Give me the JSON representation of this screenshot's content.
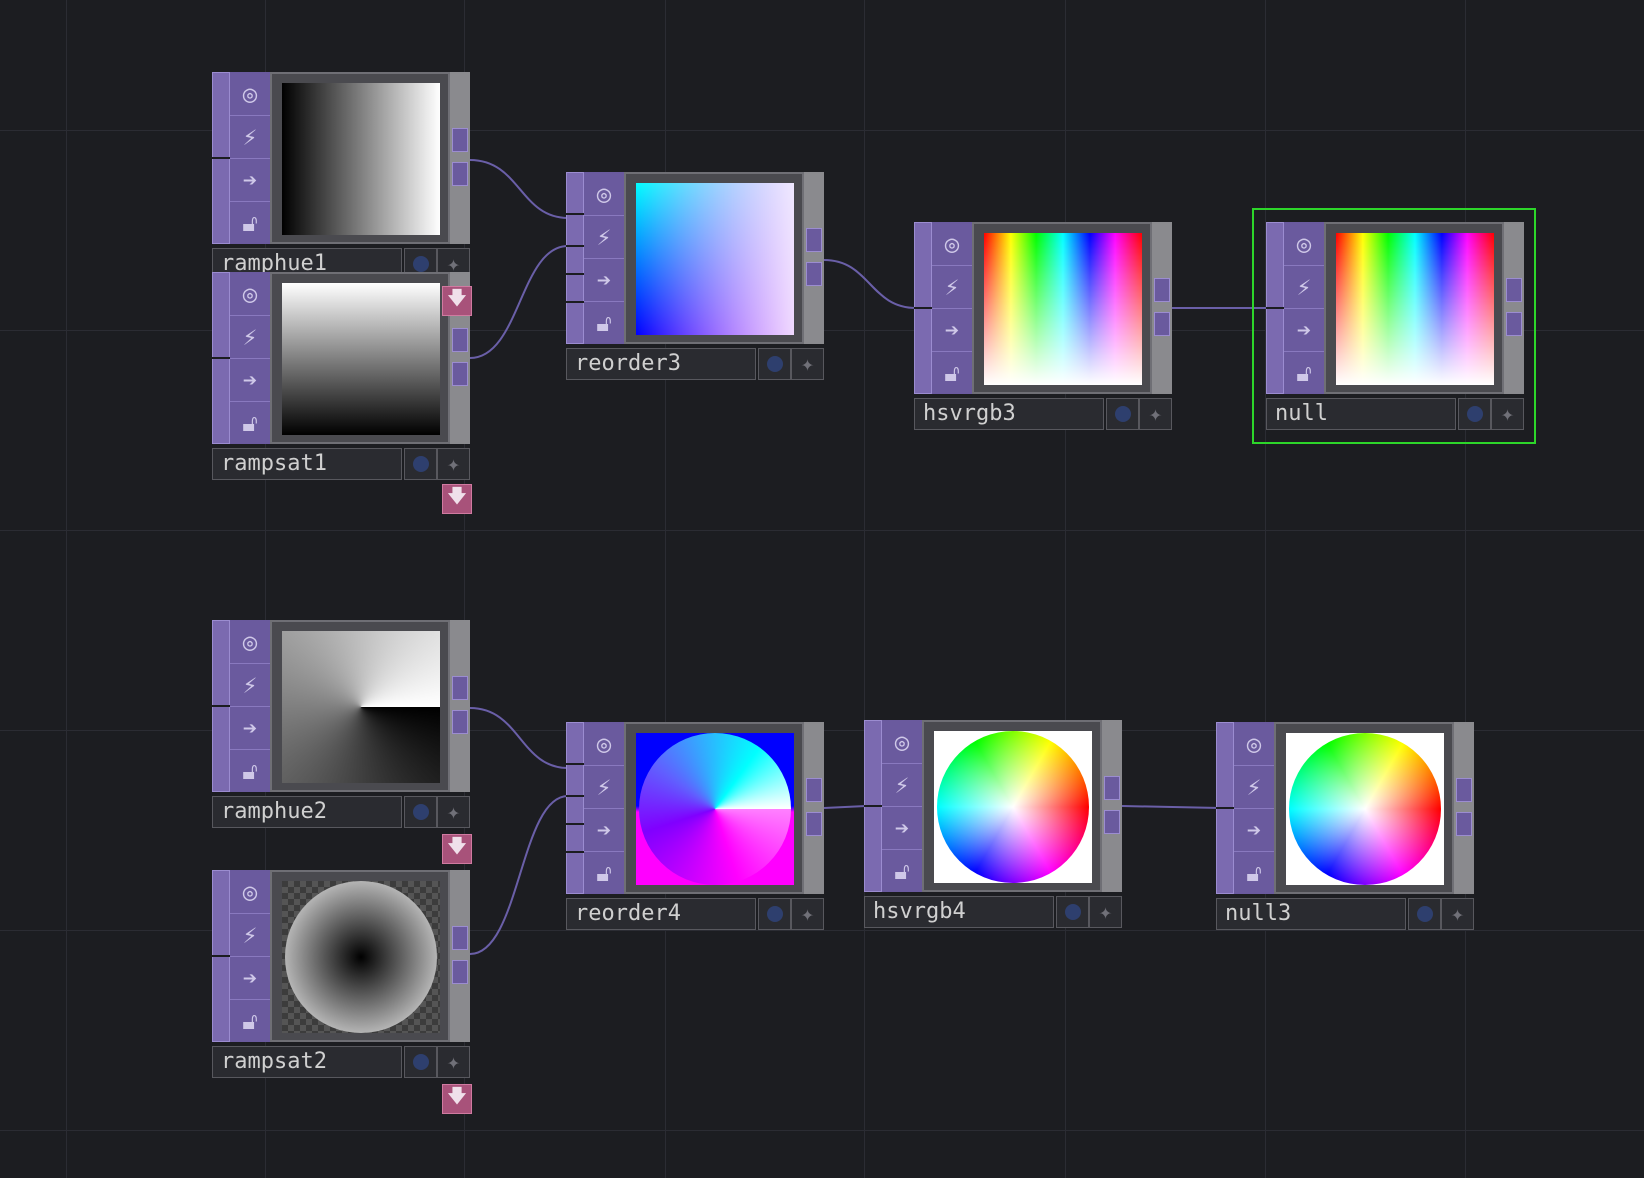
{
  "app": "TouchDesigner network editor",
  "nodes": [
    {
      "id": "ramphue1",
      "label": "ramphue1"
    },
    {
      "id": "rampsat1",
      "label": "rampsat1"
    },
    {
      "id": "reorder3",
      "label": "reorder3"
    },
    {
      "id": "hsvrgb3",
      "label": "hsvrgb3"
    },
    {
      "id": "null",
      "label": "null"
    },
    {
      "id": "ramphue2",
      "label": "ramphue2"
    },
    {
      "id": "rampsat2",
      "label": "rampsat2"
    },
    {
      "id": "reorder4",
      "label": "reorder4"
    },
    {
      "id": "hsvrgb4",
      "label": "hsvrgb4"
    },
    {
      "id": "null3",
      "label": "null3"
    }
  ],
  "icons": {
    "viewer": "viewer-icon",
    "cook": "cook-flag-icon",
    "bypass": "bypass-arrow-icon",
    "lock": "lock-icon",
    "display": "display-dot-icon",
    "render": "render-star-icon",
    "download": "download-arrow-icon"
  },
  "colors": {
    "background": "#1c1d21",
    "top_family": "#7b6ab0",
    "selection": "#2dd62a",
    "wire": "#6a5fa8",
    "badge": "#a8527a"
  },
  "selected_node": "null"
}
